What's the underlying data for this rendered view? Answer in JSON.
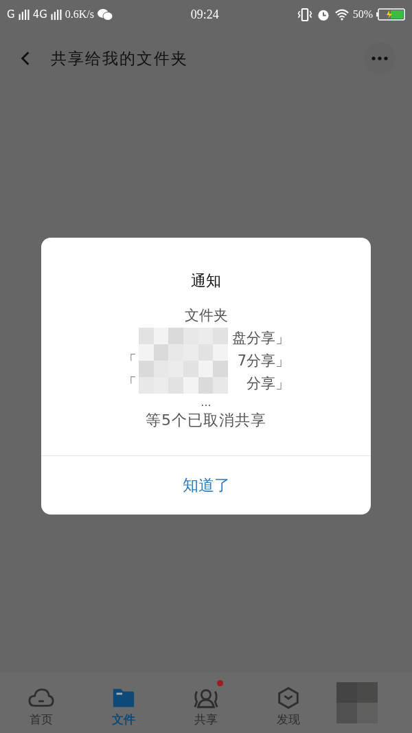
{
  "status_bar": {
    "network_1": "G",
    "network_2": "4G",
    "speed": "0.6K/s",
    "time": "09:24",
    "battery": "50%"
  },
  "header": {
    "title": "共享给我的文件夹"
  },
  "dialog": {
    "title": "通知",
    "lines": [
      {
        "kind": "center",
        "text": "文件夹"
      },
      {
        "kind": "split",
        "end": "盘分享」"
      },
      {
        "kind": "split",
        "start": "「",
        "end": "7分享」"
      },
      {
        "kind": "split",
        "start": "「",
        "end": "分享」"
      }
    ],
    "ellipsis": "...",
    "summary": "等5个已取消共享",
    "button": "知道了"
  },
  "tabs": [
    {
      "label": "首页",
      "selected": false,
      "badge": false
    },
    {
      "label": "文件",
      "selected": true,
      "badge": false
    },
    {
      "label": "共享",
      "selected": false,
      "badge": true
    },
    {
      "label": "发现",
      "selected": false,
      "badge": false
    }
  ]
}
